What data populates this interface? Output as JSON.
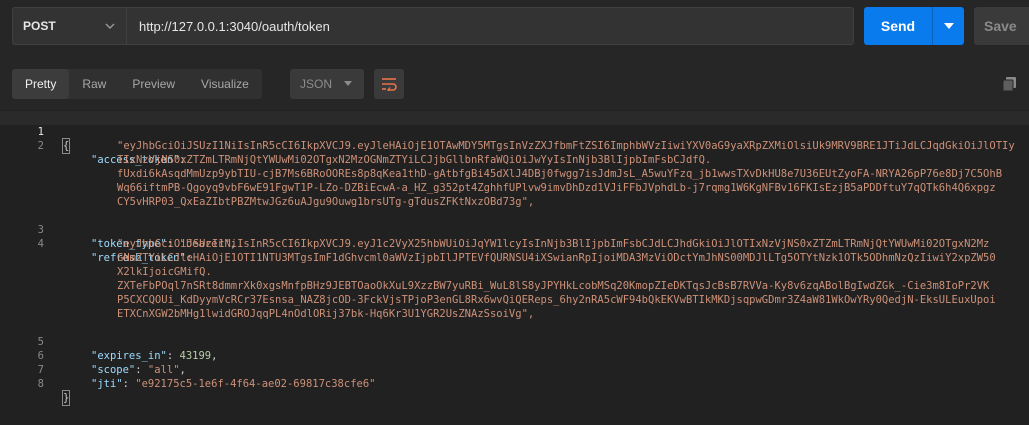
{
  "request": {
    "method": "POST",
    "url": "http://127.0.0.1:3040/oauth/token",
    "send_label": "Send",
    "save_label": "Save"
  },
  "response_toolbar": {
    "tabs": [
      "Pretty",
      "Raw",
      "Preview",
      "Visualize"
    ],
    "active_tab": "Pretty",
    "format": "JSON"
  },
  "code": {
    "line_numbers": [
      "1",
      "2",
      "3",
      "4",
      "5",
      "6",
      "7",
      "8"
    ],
    "open_brace": "{",
    "close_brace": "}",
    "access_token_key": "\"access_token\"",
    "access_token_lines": [
      "\"eyJhbGciOiJSUzI1NiIsInR5cCI6IkpXVCJ9.eyJleHAiOjE1OTAwMDY5MTgsInVzZXJfbmFtZSI6ImphbWVzIiwiYXV0aG9yaXRpZXMiOlsiUk9MRV9BRE1JTiJdLCJqdGkiOiJlOTIy",
      "TIxNzVjNS0xZTZmLTRmNjQtYWUwMi02OTgxN2MzOGNmZTYiLCJjbGllbnRfaWQiOiJwYyIsInNjb3BlIjpbImFsbCJdfQ.",
      "fUxdi6kAsqdMmUzp9ybTIU-cjB7Ms6BRoOOREs8p8qKea1thD-gAtbfgBi45dXlJ4DBj0fwgg7isJdmJsL_A5wuYFzq_jb1wwsTXvDkHU8e7U36EUtZyoFA-NRYA26pP76e8Dj7C5OhB",
      "Wq66iftmPB-Qgoyq9vbF6wE91FgwT1P-LZo-DZBiEcwA-a_HZ_g352pt4ZghhfUPlvw9imvDhDzd1VJiFFbJVphdLb-j7rqmg1W6KgNFBv16FKIsEzjB5aPDDftuY7qQTk6h4Q6xpgz",
      "CY5vHRP03_QxEaZIbtPBZMtwJGz6uAJgu9Ouwg1brsUTg-gTdusZFKtNxzOBd73g\","
    ],
    "token_type_key": "\"token_type\"",
    "token_type_value": "\"bearer\"",
    "refresh_token_key": "\"refresh_token\"",
    "refresh_token_lines": [
      "\"eyJhbGciOiJSUzI1NiIsInR5cCI6IkpXVCJ9.eyJ1c2VyX25hbWUiOiJqYW1lcyIsInNjb3BlIjpbImFsbCJdLCJhdGkiOiJlOTIxNzVjNS0xZTZmLTRmNjQtYWUwMi02OTgxN2Mz",
      "GNmZTYiLCJleHAiOjE1OTI1NTU3MTgsImF1dGhvcml0aWVzIjpbIlJPTEVfQURNSU4iXSwianRpIjoiMDA3MzViODctYmJhNS00MDJlLTg5OTYtNzk1OTk5ODhmNzQzIiwiY2xpZW50",
      "X2lkIjoicGMifQ.",
      "ZXTeFbPOql7nSRt8dmmrXk0xgsMnfpBHz9JEBTOaoOkXuL9XzzBW7yuRBi_WuL8lS8yJPYHkLcobMSq20KmopZIeDKTqsJcBsB7RVVa-Ky8v6zqABolBgIwdZGk_-Cie3m8IoPr2VK",
      "P5CXCQOUi_KdDyymVcRCr37Esnsa_NAZ8jcOD-3FckVjsTPjoP3enGL8Rx6wvQiQEReps_6hy2nRA5cWF94bQkEKVwBTIkMKDjsqpwGDmr3Z4aW81WkOwYRy0QedjN-EksULEuxUpoi",
      "ETXCnXGW2bMHg1lwidGROJqqPL4nOdlORij37bk-Hq6Kr3U1YGR2UsZNAzSsoiVg\","
    ],
    "expires_in_key": "\"expires_in\"",
    "expires_in_value": "43199",
    "scope_key": "\"scope\"",
    "scope_value": "\"all\"",
    "jti_key": "\"jti\"",
    "jti_value": "\"e92175c5-1e6f-4f64-ae02-69817c38cfe6\""
  },
  "colors": {
    "accent": "#097bed",
    "key": "#9cdcfe",
    "string": "#ce9178",
    "number": "#b5cea8",
    "wrap_icon": "#e8734b"
  },
  "icons": [
    "chevron-down-icon",
    "word-wrap-icon",
    "copy-icon"
  ]
}
